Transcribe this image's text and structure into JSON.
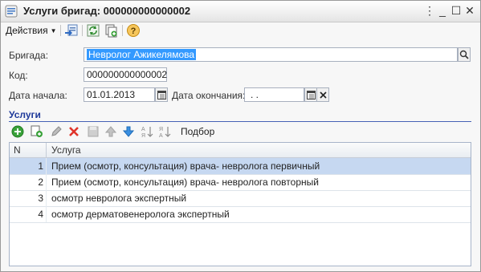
{
  "window": {
    "title": "Услуги бригад: 000000000000002",
    "controls": {
      "menu": "⋮",
      "minimize": "_",
      "maximize": "☐",
      "close": "✕"
    }
  },
  "toolbar": {
    "actions_label": "Действия",
    "icons": [
      "move-to-list-icon",
      "refresh-icon",
      "copy-icon",
      "help-icon"
    ]
  },
  "form": {
    "brigade_label": "Бригада:",
    "brigade_value": "Невролог Ажикелямова",
    "code_label": "Код:",
    "code_value": "000000000000002",
    "start_label": "Дата начала:",
    "start_value": "01.01.2013",
    "end_label": "Дата окончания:",
    "end_value": ". ."
  },
  "services": {
    "section_title": "Услуги",
    "pick_label": "Подбор",
    "columns": {
      "n": "N",
      "service": "Услуга"
    },
    "rows": [
      {
        "n": "1",
        "service": "Прием (осмотр, консультация) врача- невролога первичный",
        "selected": true
      },
      {
        "n": "2",
        "service": "Прием (осмотр, консультация) врача- невролога повторный",
        "selected": false
      },
      {
        "n": "3",
        "service": "осмотр невролога экспертный",
        "selected": false
      },
      {
        "n": "4",
        "service": "осмотр дерматовенеролога экспертный",
        "selected": false
      }
    ]
  },
  "colors": {
    "section_title": "#1f3a9a",
    "selection": "#3399ff",
    "selected_row": "#c6d8f1"
  }
}
